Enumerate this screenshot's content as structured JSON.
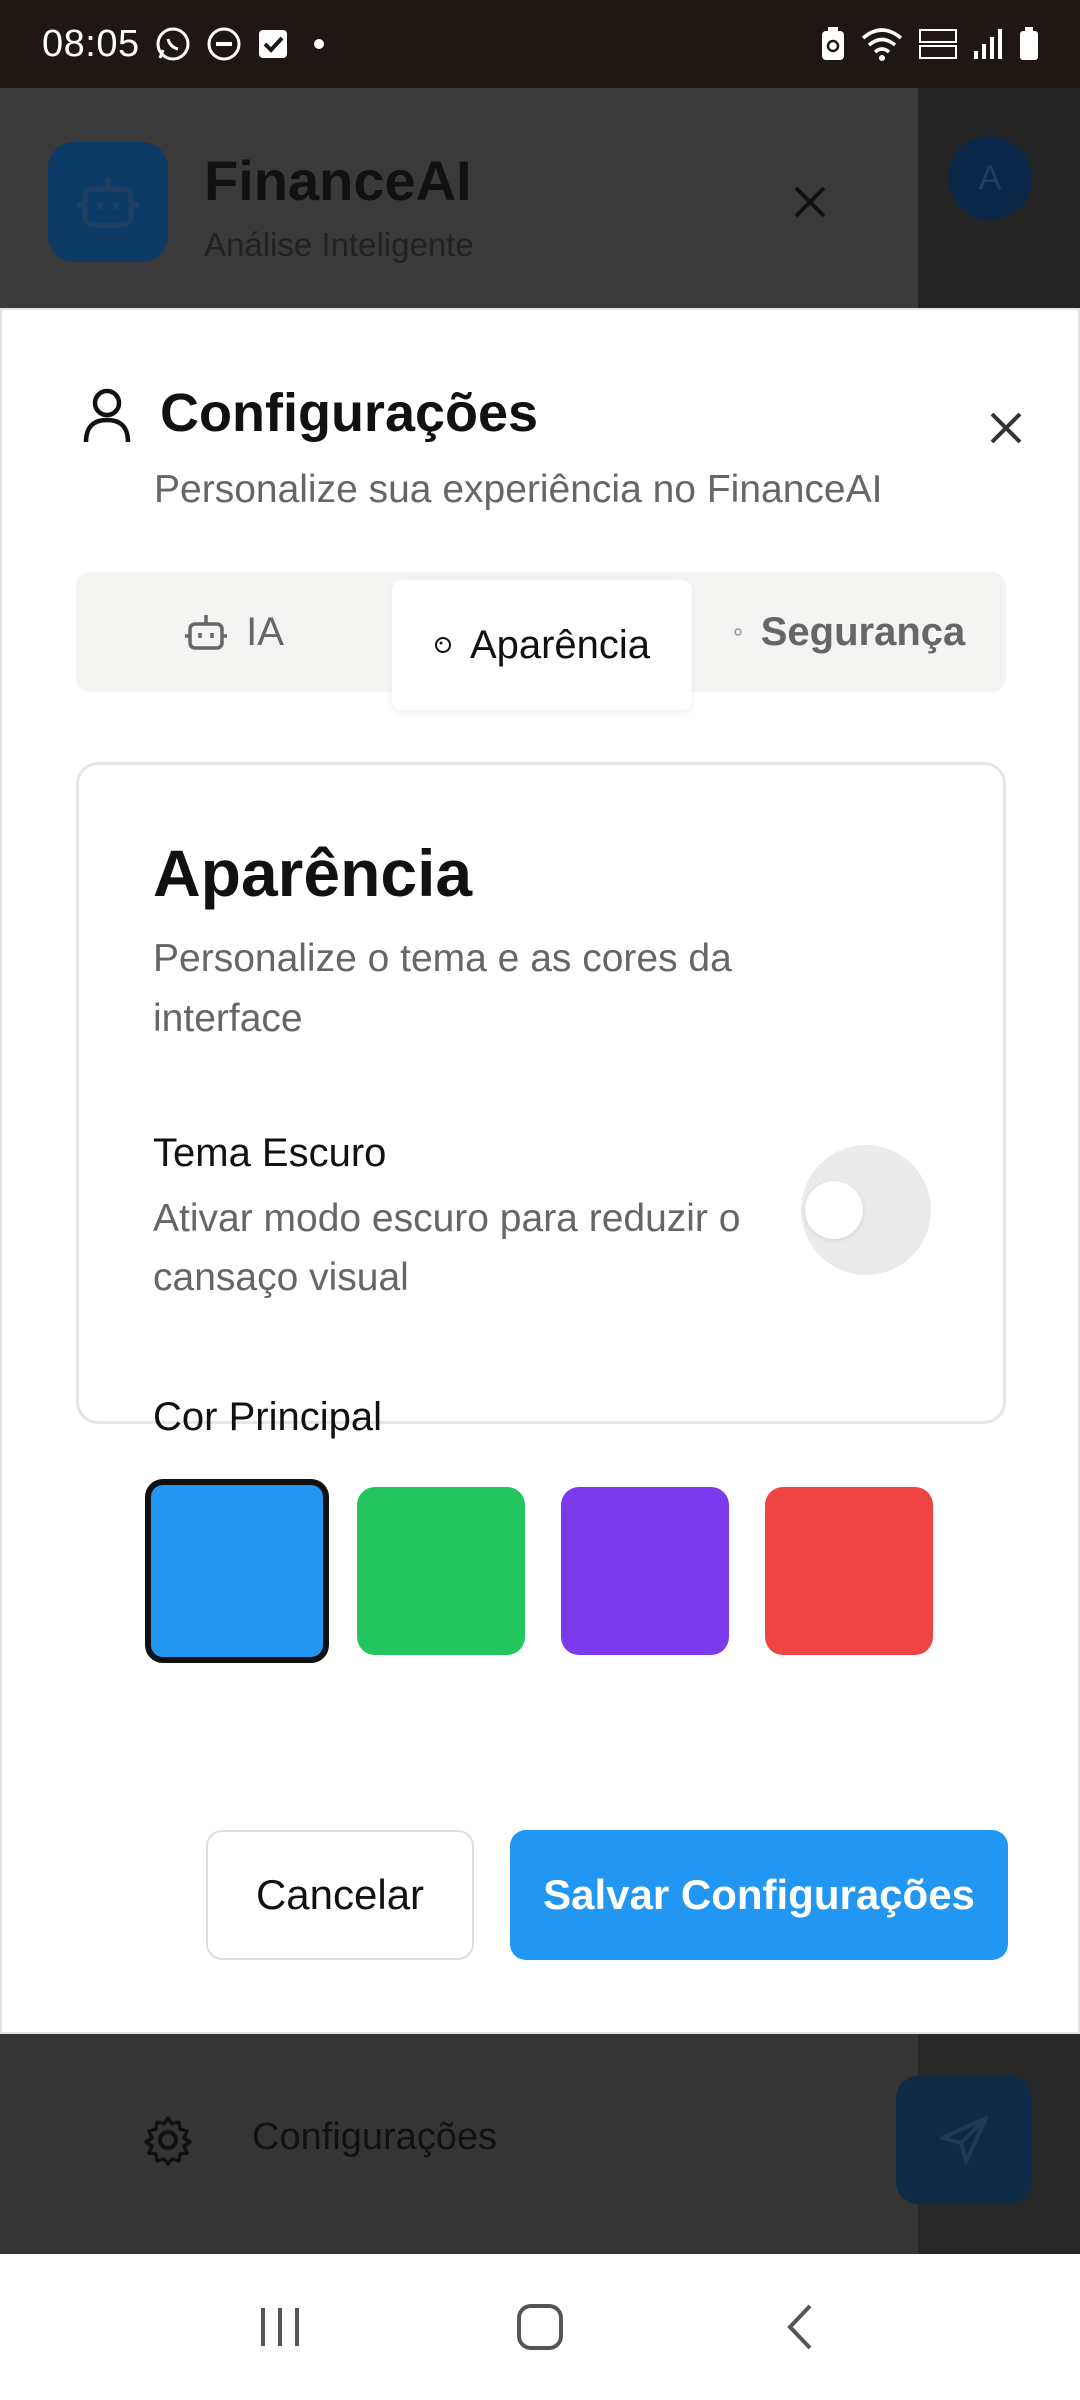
{
  "status_bar": {
    "time": "08:05"
  },
  "app": {
    "title": "FinanceAI",
    "subtitle": "Análise Inteligente",
    "avatar_initial": "A",
    "footer_label": "Configurações",
    "icons": [
      "robot-icon",
      "close-icon",
      "gear-icon",
      "send-icon"
    ]
  },
  "modal": {
    "title": "Configurações",
    "subtitle": "Personalize sua experiência no FinanceAI",
    "tabs": [
      {
        "label": "IA",
        "icon": "robot-icon",
        "active": false
      },
      {
        "label": "Aparência",
        "icon": "palette-icon",
        "active": true
      },
      {
        "label": "Segurança",
        "icon": "shield-icon",
        "active": false
      }
    ],
    "section": {
      "title": "Aparência",
      "description": "Personalize o tema e as cores da interface"
    },
    "dark_theme": {
      "title": "Tema Escuro",
      "description": "Ativar modo escuro para reduzir o cansaço visual",
      "enabled": false
    },
    "primary_color": {
      "title": "Cor Principal",
      "options": [
        "#2196f3",
        "#22c55e",
        "#7c3aed",
        "#ef4444"
      ],
      "selected": "#2196f3"
    },
    "buttons": {
      "cancel": "Cancelar",
      "save": "Salvar Configurações"
    }
  },
  "colors": {
    "accent": "#2196f3",
    "status_bar": "#1f1714",
    "overlay": "#353535"
  }
}
